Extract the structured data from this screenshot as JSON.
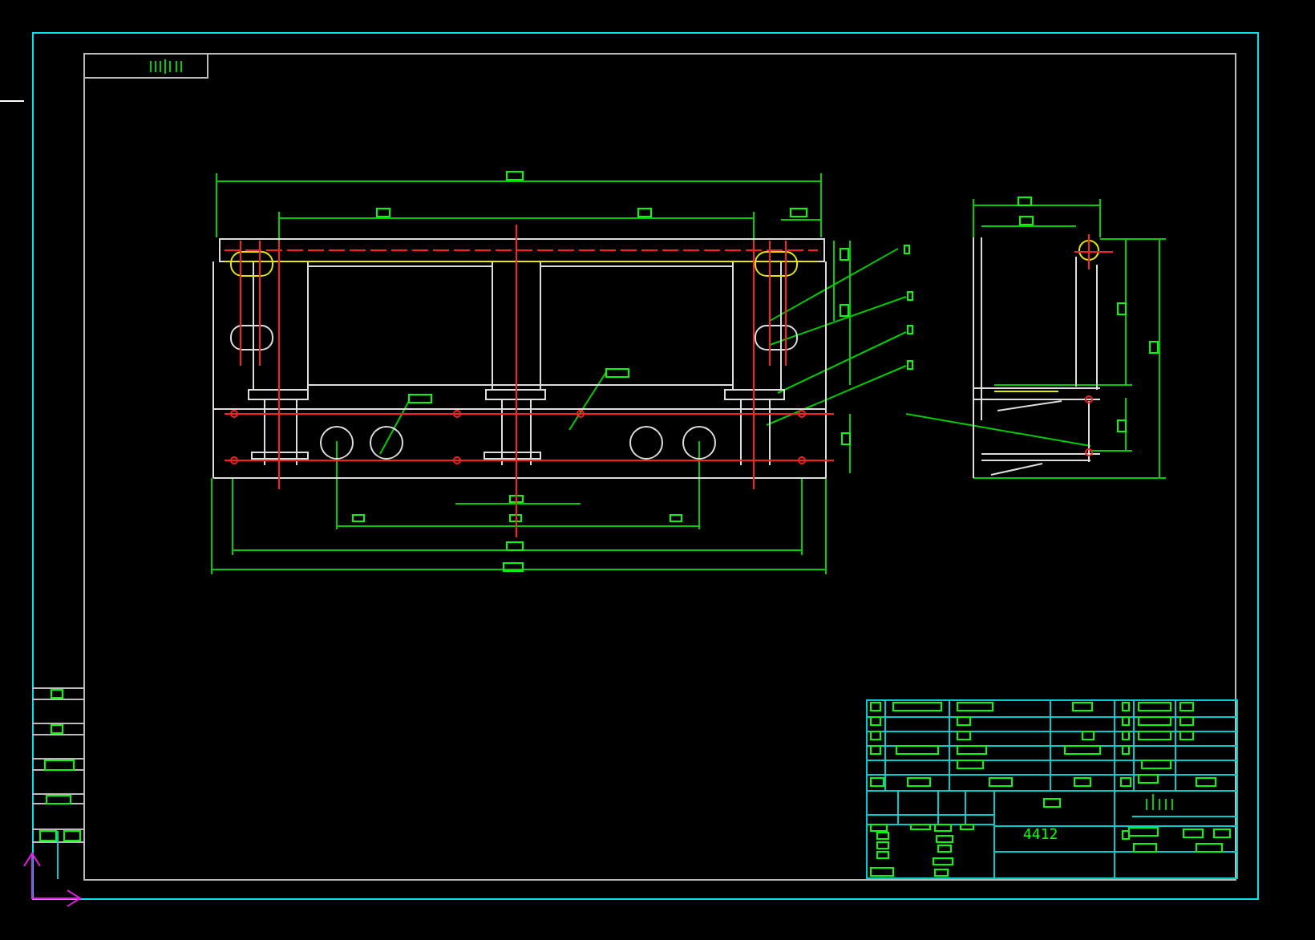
{
  "drawing": {
    "title_block": {
      "drawing_number": "4412"
    }
  }
}
